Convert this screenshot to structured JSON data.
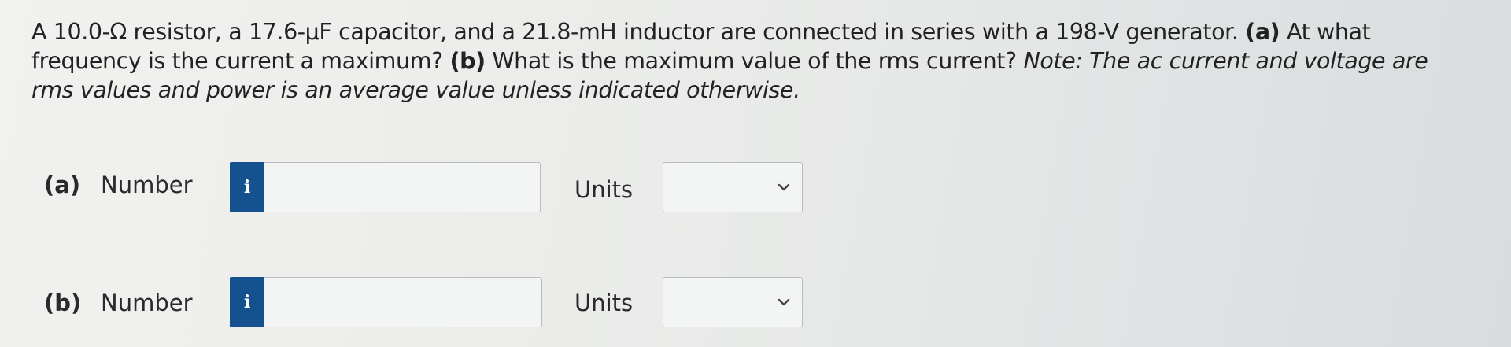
{
  "question": {
    "intro": "A 10.0-Ω resistor, a 17.6-μF capacitor, and a 21.8-mH inductor are connected in series with a 198-V generator.",
    "part_a_label": "(a)",
    "part_a_text": "At what frequency is the current a maximum?",
    "part_b_label": "(b)",
    "part_b_text": "What is the maximum value of the rms current?",
    "note": "Note: The ac current and voltage are rms values and power is an average value unless indicated otherwise."
  },
  "parts": [
    {
      "letter": "(a)",
      "number_label": "Number",
      "info_icon": "info-icon",
      "value": "",
      "units_label": "Units",
      "units_value": ""
    },
    {
      "letter": "(b)",
      "number_label": "Number",
      "info_icon": "info-icon",
      "value": "",
      "units_label": "Units",
      "units_value": ""
    }
  ],
  "info_glyph": "i",
  "colors": {
    "info_button": "#15518f",
    "text": "#222222",
    "input_border": "#b9bcbf"
  }
}
